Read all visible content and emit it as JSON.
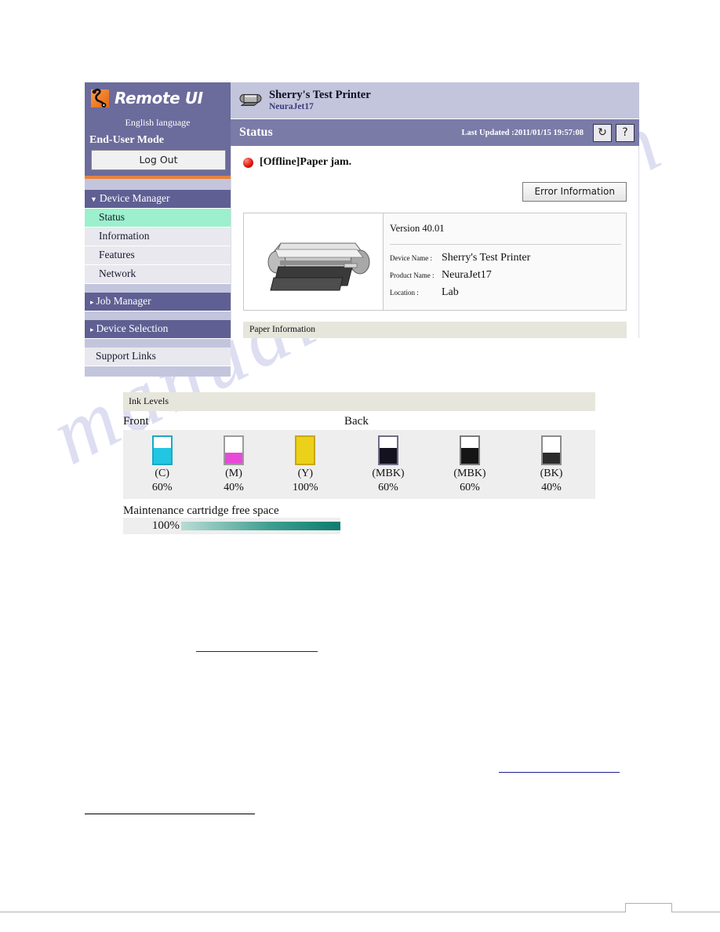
{
  "watermark": "manualshive.com",
  "sidebar": {
    "brand": "Remote UI",
    "logo_icon": "remote-ui-logo-icon",
    "language": "English language",
    "mode": "End-User Mode",
    "logout_label": "Log Out",
    "groups": [
      {
        "label": "Device Manager",
        "expanded": true,
        "marker": "▼",
        "items": [
          {
            "label": "Status",
            "active": true
          },
          {
            "label": "Information",
            "active": false
          },
          {
            "label": "Features",
            "active": false
          },
          {
            "label": "Network",
            "active": false
          }
        ]
      },
      {
        "label": "Job Manager",
        "expanded": false,
        "marker": "▸",
        "items": []
      },
      {
        "label": "Device Selection",
        "expanded": false,
        "marker": "▸",
        "items": []
      }
    ],
    "support_links": "Support Links"
  },
  "device_header": {
    "printer_icon": "printer-icon",
    "name": "Sherry's Test Printer",
    "model": "NeuraJet17"
  },
  "status_bar": {
    "title": "Status",
    "last_updated": "Last Updated :2011/01/15 19:57:08",
    "refresh_icon": "↻",
    "refresh_icon_name": "refresh-icon",
    "help_icon": "?",
    "help_icon_name": "help-icon"
  },
  "alert": {
    "status_icon": "error-dot-icon",
    "message": "[Offline]Paper jam.",
    "error_button": "Error Information"
  },
  "device_info": {
    "printer_image_name": "printer-illustration",
    "version": "Version 40.01",
    "rows": [
      {
        "label": "Device Name :",
        "value": "Sherry's Test Printer"
      },
      {
        "label": "Product Name :",
        "value": "NeuraJet17"
      },
      {
        "label": "Location :",
        "value": "Lab"
      }
    ]
  },
  "paper_information": {
    "title": "Paper Information"
  },
  "ink_levels": {
    "title": "Ink Levels",
    "front_label": "Front",
    "back_label": "Back",
    "front": [
      {
        "code": "(C)",
        "percent": "60%",
        "level": 60,
        "color": "#22c6e2",
        "border": "#1aa9c4"
      },
      {
        "code": "(M)",
        "percent": "40%",
        "level": 40,
        "color": "#e84ad8",
        "border": "#9b9b9b"
      },
      {
        "code": "(Y)",
        "percent": "100%",
        "level": 100,
        "color": "#ecd11a",
        "border": "#c9a800"
      }
    ],
    "back": [
      {
        "code": "(MBK)",
        "percent": "60%",
        "level": 60,
        "color": "#14121f",
        "border": "#6d6d84"
      },
      {
        "code": "(MBK)",
        "percent": "60%",
        "level": 60,
        "color": "#151515",
        "border": "#7a7a7a"
      },
      {
        "code": "(BK)",
        "percent": "40%",
        "level": 40,
        "color": "#2c2c2c",
        "border": "#8b8b8b"
      }
    ]
  },
  "maintenance": {
    "title": "Maintenance cartridge free space",
    "percent": "100%",
    "level": 100
  }
}
